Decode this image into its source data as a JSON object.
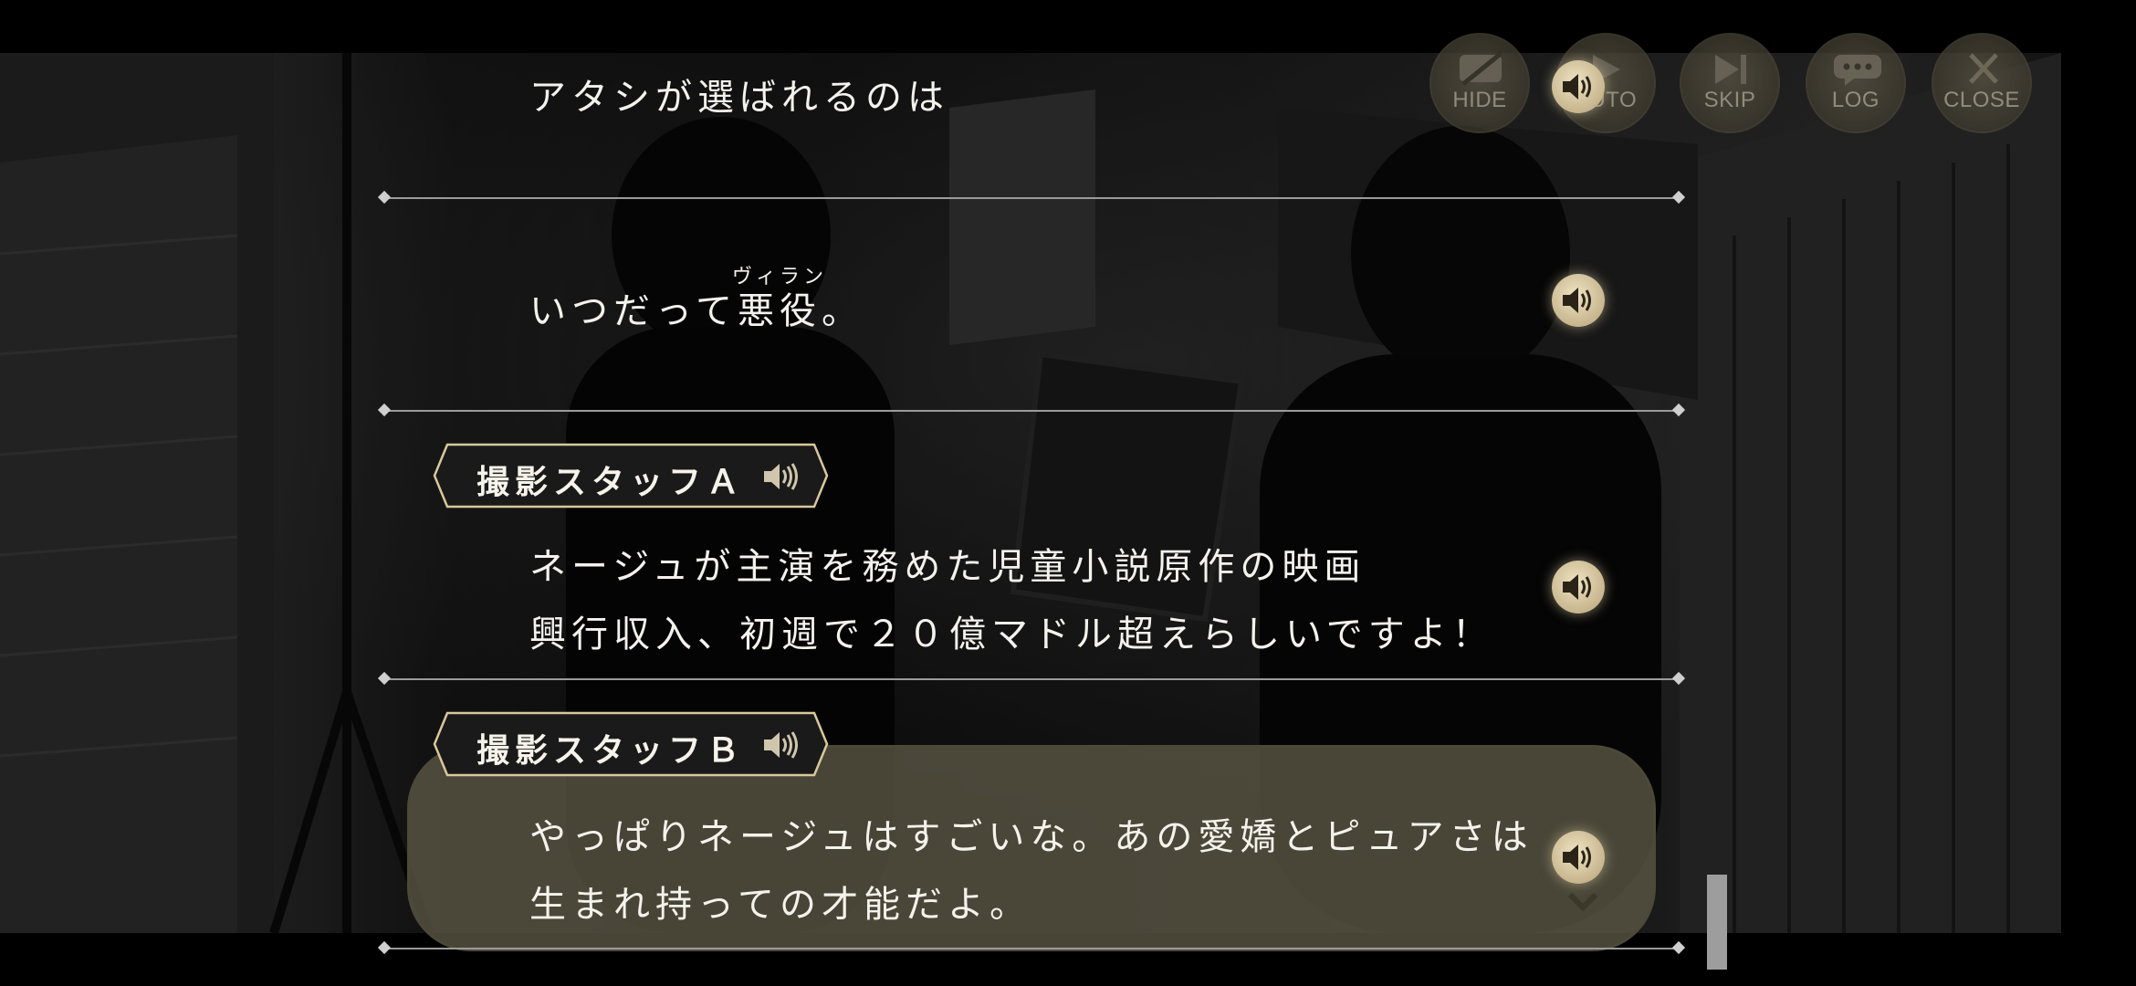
{
  "toolbar": {
    "hide_label": "HIDE",
    "auto_label": "AUTO",
    "skip_label": "SKIP",
    "log_label": "LOG",
    "close_label": "CLOSE"
  },
  "log": {
    "entries": [
      {
        "speaker": "",
        "lines": [
          "アタシが選ばれるのは"
        ]
      },
      {
        "speaker": "",
        "lines": [
          "いつだって悪役。"
        ],
        "ruby": "ヴィラン"
      },
      {
        "speaker": "撮影スタッフＡ",
        "lines": [
          "ネージュが主演を務めた児童小説原作の映画",
          "興行収入、初週で２０億マドル超えらしいですよ！"
        ]
      },
      {
        "speaker": "撮影スタッフＢ",
        "lines": [
          "やっぱりネージュはすごいな。あの愛嬌とピュアさは",
          "生まれ持っての才能だよ。"
        ]
      }
    ]
  },
  "colors": {
    "accent_gold": "#d9c89c",
    "panel": "#5c5846"
  },
  "icons": {
    "voice": "speaker-icon",
    "hide": "hide-icon",
    "auto": "auto-icon",
    "skip": "skip-icon",
    "log": "log-icon",
    "close": "close-icon",
    "next": "chevron-down-icon"
  }
}
